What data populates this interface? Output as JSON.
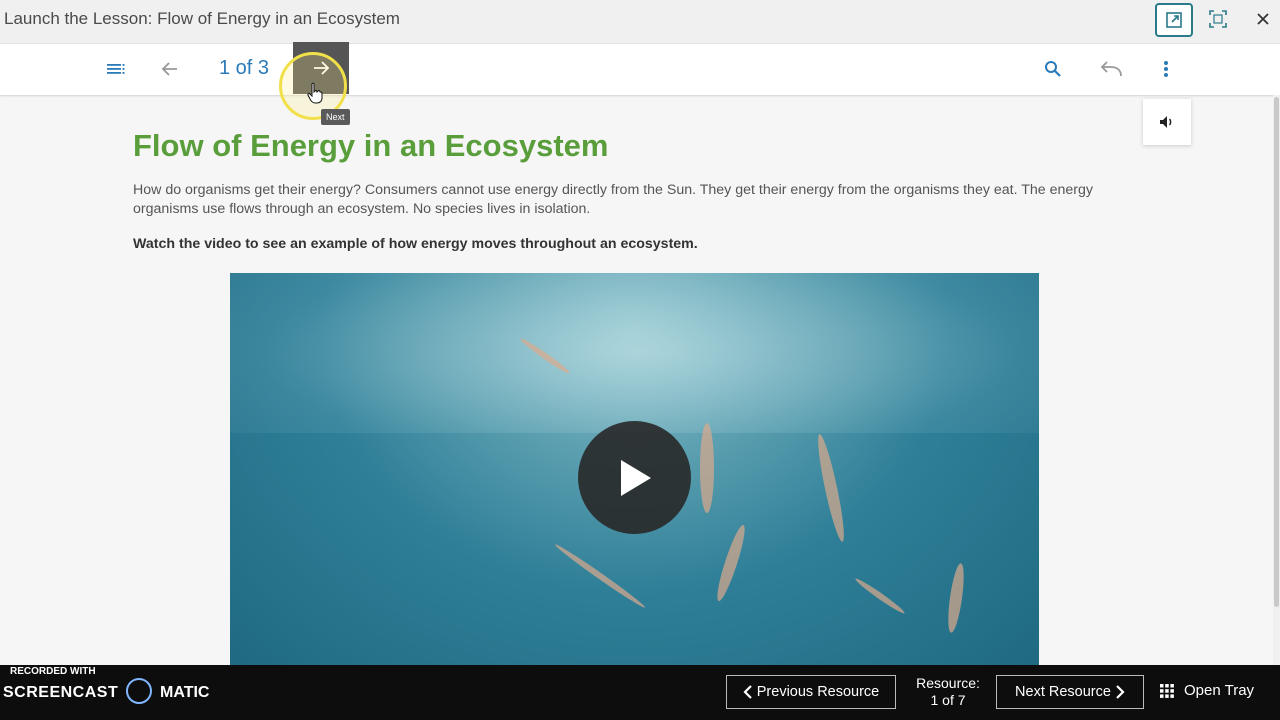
{
  "window": {
    "title": "Launch the Lesson: Flow of Energy in an Ecosystem"
  },
  "toolbar": {
    "page_indicator": "1 of 3",
    "next_tooltip": "Next"
  },
  "content": {
    "heading": "Flow of Energy in an Ecosystem",
    "paragraph": "How do organisms get their energy? Consumers cannot use energy directly from the Sun. They get their energy from the organisms they eat. The energy organisms use flows through an ecosystem. No species lives in isolation.",
    "instruction": "Watch the video to see an example of how energy moves throughout an ecosystem."
  },
  "bottom": {
    "recorded_label": "RECORDED WITH",
    "brand_left": "SCREENCAST",
    "brand_right": "MATIC",
    "previous_label": "Previous Resource",
    "resource_label": "Resource:",
    "resource_count": "1 of 7",
    "next_label": "Next Resource",
    "tray_label": "Open Tray"
  },
  "colors": {
    "heading": "#5a9e3c",
    "accent": "#2b7bb9",
    "bottom_bar": "#0d0d0d"
  }
}
